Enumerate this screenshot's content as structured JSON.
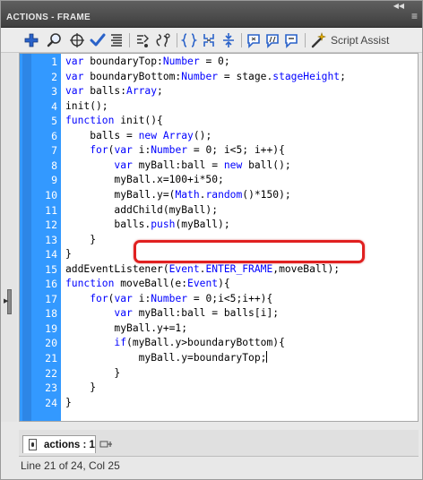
{
  "panel": {
    "title": "ACTIONS - FRAME",
    "collapse_icon": "double-chevron-icon",
    "menu_icon": "hamburger-menu-icon"
  },
  "toolbar": {
    "buttons": [
      {
        "name": "add-script-item-button",
        "icon": "plus-icon"
      },
      {
        "name": "find-button",
        "icon": "magnifier-icon"
      },
      {
        "name": "insert-target-path-button",
        "icon": "crosshair-icon"
      },
      {
        "name": "check-syntax-button",
        "icon": "checkmark-icon"
      },
      {
        "name": "auto-format-button",
        "icon": "auto-format-icon"
      },
      {
        "name": "code-hint-button",
        "icon": "code-hint-icon"
      },
      {
        "name": "debug-options-button",
        "icon": "debug-icon"
      },
      {
        "name": "collapse-between-braces-button",
        "icon": "collapse-braces-icon"
      },
      {
        "name": "collapse-selection-button",
        "icon": "collapse-selection-icon"
      },
      {
        "name": "expand-all-button",
        "icon": "expand-all-icon"
      },
      {
        "name": "apply-block-comment-button",
        "icon": "block-comment-icon"
      },
      {
        "name": "apply-line-comment-button",
        "icon": "line-comment-icon"
      },
      {
        "name": "remove-comment-button",
        "icon": "remove-comment-icon"
      }
    ],
    "script_assist_label": "Script Assist",
    "script_assist_icon": "wand-icon"
  },
  "editor": {
    "line_numbers": [
      "1",
      "2",
      "3",
      "4",
      "5",
      "6",
      "7",
      "8",
      "9",
      "10",
      "11",
      "12",
      "13",
      "14",
      "15",
      "16",
      "17",
      "18",
      "19",
      "20",
      "21",
      "22",
      "23",
      "24"
    ],
    "lines": [
      "var boundaryTop:Number = 0;",
      "var boundaryBottom:Number = stage.stageHeight;",
      "var balls:Array;",
      "init();",
      "function init(){",
      "    balls = new Array();",
      "    for(var i:Number = 0; i<5; i++){",
      "        var myBall:ball = new ball();",
      "        myBall.x=100+i*50;",
      "        myBall.y=(Math.random()*150);",
      "        addChild(myBall);",
      "        balls.push(myBall);",
      "    }",
      "}",
      "addEventListener(Event.ENTER_FRAME,moveBall);",
      "function moveBall(e:Event){",
      "    for(var i:Number = 0;i<5;i++){",
      "        var myBall:ball = balls[i];",
      "        myBall.y+=1;",
      "        if(myBall.y>boundaryBottom){",
      "            myBall.y=boundaryTop;",
      "        }",
      "    }",
      "}"
    ],
    "highlighted_line": 10,
    "highlight_color": "#e02020",
    "gutter_color": "#3399ff"
  },
  "tabs": [
    {
      "label": "actions : 1",
      "icon": "actionscript-file-icon"
    }
  ],
  "pin_icon": "pin-script-icon",
  "status_text": "Line 21 of 24, Col 25"
}
